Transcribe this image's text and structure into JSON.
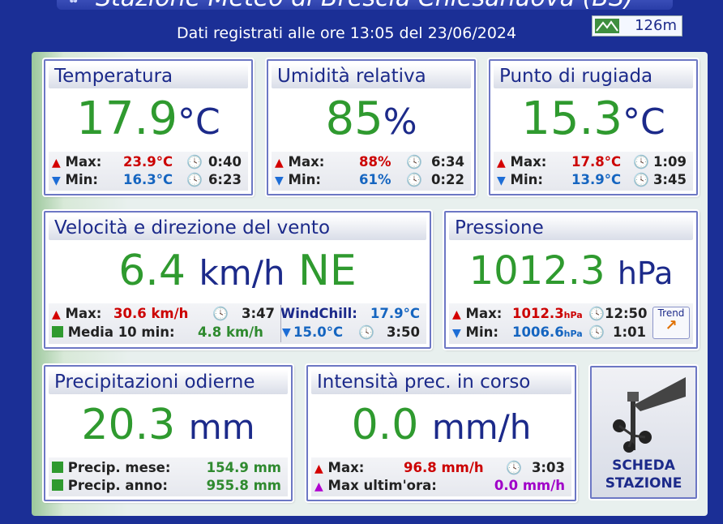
{
  "header": {
    "title": "Stazione Meteo di Brescia Chiesanuova (BS)",
    "timestamp": "Dati registrati alle ore 13:05 del 23/06/2024",
    "altitude": "126m"
  },
  "temperature": {
    "title": "Temperatura",
    "value": "17.9",
    "unit": "°C",
    "max_label": "Max:",
    "max_value": "23.9°C",
    "max_time": "0:40",
    "min_label": "Min:",
    "min_value": "16.3°C",
    "min_time": "6:23"
  },
  "humidity": {
    "title": "Umidità relativa",
    "value": "85",
    "unit": "%",
    "max_label": "Max:",
    "max_value": "88%",
    "max_time": "6:34",
    "min_label": "Min:",
    "min_value": "61%",
    "min_time": "0:22"
  },
  "dewpoint": {
    "title": "Punto di rugiada",
    "value": "15.3",
    "unit": "°C",
    "max_label": "Max:",
    "max_value": "17.8°C",
    "max_time": "1:09",
    "min_label": "Min:",
    "min_value": "13.9°C",
    "min_time": "3:45"
  },
  "wind": {
    "title": "Velocità e direzione del vento",
    "value": "6.4",
    "unit": "km/h",
    "direction": "NE",
    "max_label": "Max:",
    "max_value": "30.6 km/h",
    "max_time": "3:47",
    "avg_label": "Media 10 min:",
    "avg_value": "4.8 km/h",
    "windchill_label": "WindChill:",
    "windchill_value": "17.9°C",
    "windchill_min_value": "15.0°C",
    "windchill_min_time": "3:50"
  },
  "pressure": {
    "title": "Pressione",
    "value": "1012.3",
    "unit": "hPa",
    "max_label": "Max:",
    "max_value": "1012.3",
    "max_unit": "hPa",
    "max_time": "12:50",
    "min_label": "Min:",
    "min_value": "1006.6",
    "min_unit": "hPa",
    "min_time": "1:01",
    "trend_label": "Trend"
  },
  "rain": {
    "title": "Precipitazioni odierne",
    "value": "20.3",
    "unit": "mm",
    "month_label": "Precip. mese:",
    "month_value": "154.9 mm",
    "year_label": "Precip. anno:",
    "year_value": "955.8 mm"
  },
  "rainrate": {
    "title": "Intensità prec. in corso",
    "value": "0.0",
    "unit": "mm/h",
    "max_label": "Max:",
    "max_value": "96.8 mm/h",
    "max_time": "3:03",
    "lasthour_label": "Max ultim'ora:",
    "lasthour_value": "0.0 mm/h"
  },
  "station": {
    "label_line1": "SCHEDA",
    "label_line2": "STAZIONE"
  },
  "icons": {
    "up": "▲",
    "down": "▼",
    "clock": "🕓"
  },
  "colors": {
    "background": "#1b2f96",
    "value_green": "#2f9a2f",
    "max_red": "#cc0000",
    "min_blue": "#1565c0",
    "purple": "#a000c8"
  }
}
